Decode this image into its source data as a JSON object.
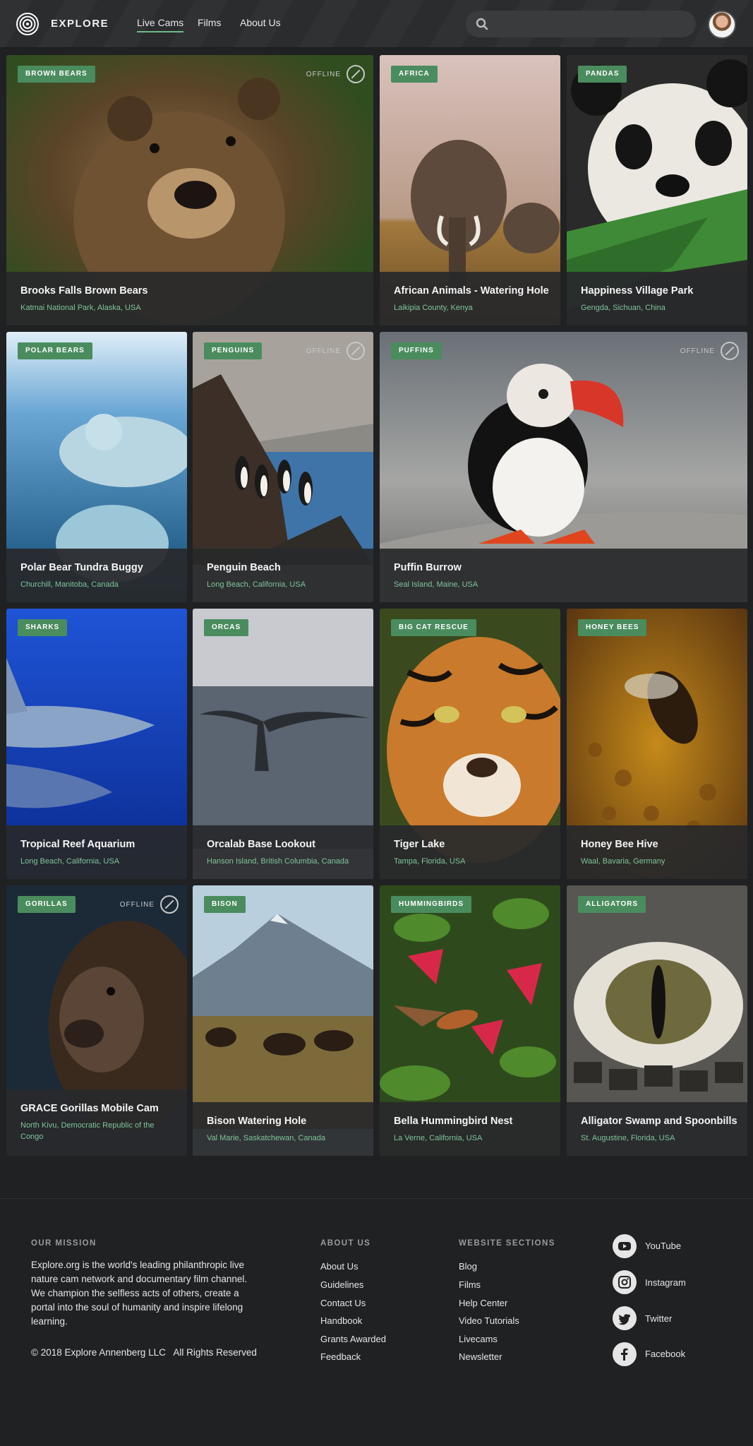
{
  "header": {
    "brand": "EXPLORE",
    "nav": [
      "Live Cams",
      "Films",
      "About Us"
    ],
    "active_nav": "Live Cams",
    "search_placeholder": ""
  },
  "offline_label": "OFFLINE",
  "cards": [
    {
      "tag": "BROWN BEARS",
      "title": "Brooks Falls Brown Bears",
      "location": "Katmai National Park, Alaska, USA",
      "offline": true
    },
    {
      "tag": "AFRICA",
      "title": "African Animals - Watering Hole",
      "location": "Laikipia County, Kenya",
      "offline": false
    },
    {
      "tag": "PANDAS",
      "title": "Happiness Village Park",
      "location": "Gengda, Sichuan, China",
      "offline": false
    },
    {
      "tag": "POLAR BEARS",
      "title": "Polar Bear Tundra Buggy",
      "location": "Churchill, Manitoba, Canada",
      "offline": false
    },
    {
      "tag": "PENGUINS",
      "title": "Penguin Beach",
      "location": "Long Beach, California, USA",
      "offline": true
    },
    {
      "tag": "PUFFINS",
      "title": "Puffin Burrow",
      "location": "Seal Island, Maine, USA",
      "offline": true
    },
    {
      "tag": "SHARKS",
      "title": "Tropical Reef Aquarium",
      "location": "Long Beach, California, USA",
      "offline": false
    },
    {
      "tag": "ORCAS",
      "title": "Orcalab Base Lookout",
      "location": "Hanson Island, British Columbia, Canada",
      "offline": false
    },
    {
      "tag": "BIG CAT RESCUE",
      "title": "Tiger Lake",
      "location": "Tampa, Florida, USA",
      "offline": false
    },
    {
      "tag": "HONEY BEES",
      "title": "Honey Bee Hive",
      "location": "Waal, Bavaria, Germany",
      "offline": false
    },
    {
      "tag": "GORILLAS",
      "title": "GRACE Gorillas Mobile Cam",
      "location": "North Kivu, Democratic Republic of the Congo",
      "offline": true
    },
    {
      "tag": "BISON",
      "title": "Bison Watering Hole",
      "location": "Val Marie, Saskatchewan, Canada",
      "offline": false
    },
    {
      "tag": "HUMMINGBIRDS",
      "title": "Bella Hummingbird Nest",
      "location": "La Verne, California, USA",
      "offline": false
    },
    {
      "tag": "ALLIGATORS",
      "title": "Alligator Swamp and Spoonbills",
      "location": "St. Augustine, Florida, USA",
      "offline": false
    }
  ],
  "footer": {
    "mission_heading": "OUR MISSION",
    "mission_text": "Explore.org is the world's leading philanthropic live nature cam network and documentary film channel. We champion the selfless acts of others, create a portal into the soul of humanity and inspire lifelong learning.",
    "copyright": "© 2018 Explore Annenberg LLC   All Rights Reserved",
    "about_heading": "ABOUT US",
    "about_links": [
      "About Us",
      "Guidelines",
      "Contact Us",
      "Handbook",
      "Grants Awarded",
      "Feedback"
    ],
    "sections_heading": "WEBSITE SECTIONS",
    "section_links": [
      "Blog",
      "Films",
      "Help Center",
      "Video Tutorials",
      "Livecams",
      "Newsletter"
    ],
    "social": [
      "YouTube",
      "Instagram",
      "Twitter",
      "Facebook"
    ]
  }
}
